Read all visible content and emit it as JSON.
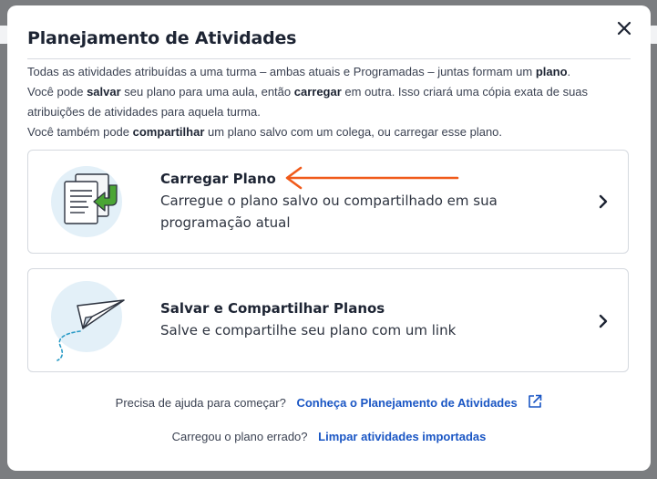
{
  "dialog": {
    "title": "Planejamento de Atividades",
    "intro": {
      "line1_a": "Todas as atividades atribuídas a uma turma – ambas atuais e Programadas – juntas formam um ",
      "line1_b": "plano",
      "line1_c": ".",
      "line2_a": "Você pode ",
      "line2_b": "salvar",
      "line2_c": " seu plano para uma aula, então ",
      "line2_d": "carregar",
      "line2_e": " em outra. Isso criará uma cópia exata de suas",
      "line3": "atribuições de atividades para aquela turma.",
      "line4_a": "Você também pode ",
      "line4_b": "compartilhar",
      "line4_c": " um plano salvo com um colega, ou carregar esse plano."
    }
  },
  "cards": {
    "load": {
      "title": "Carregar Plano",
      "description": "Carregue o plano salvo ou compartilhado em sua programação atual",
      "icon": "document-load-icon"
    },
    "save": {
      "title": "Salvar e Compartilhar Planos",
      "description": "Salve e compartilhe seu plano com um link",
      "icon": "paper-plane-icon"
    }
  },
  "help": {
    "prompt": "Precisa de ajuda para começar?",
    "link": "Conheça o Planejamento de Atividades"
  },
  "wrong_plan": {
    "prompt": "Carregou o plano errado?",
    "link": "Limpar atividades importadas"
  },
  "colors": {
    "link": "#1a56c4",
    "annotation_arrow": "#f05a1a",
    "icon_green": "#4aa535",
    "icon_circle": "#e3f0f8"
  }
}
